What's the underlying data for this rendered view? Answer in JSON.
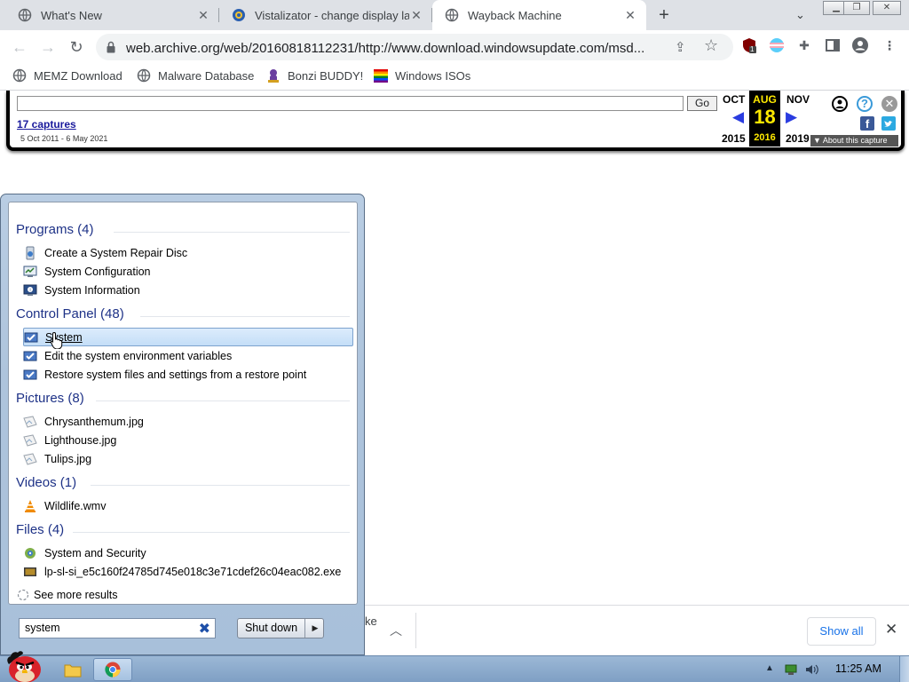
{
  "tabs": [
    {
      "title": "What's New",
      "icon": "globe-icon",
      "state": "inactive"
    },
    {
      "title": "Vistalizator - change display la",
      "icon": "vistalizator-icon",
      "state": "inactive"
    },
    {
      "title": "Wayback Machine",
      "icon": "globe-icon",
      "state": "active"
    }
  ],
  "omnibox": {
    "url": "web.archive.org/web/20160818112231/http://www.download.windowsupdate.com/msd..."
  },
  "extensions": {
    "badge_count": "1"
  },
  "bookmarks": [
    {
      "label": "MEMZ Download",
      "icon": "globe-icon"
    },
    {
      "label": "Malware Database",
      "icon": "globe-icon"
    },
    {
      "label": "Bonzi BUDDY!",
      "icon": "bonzi-icon"
    },
    {
      "label": "Windows ISOs",
      "icon": "windows-flag-icon"
    }
  ],
  "wayback": {
    "go_label": "Go",
    "captures": "17 captures",
    "range": "5 Oct 2011 - 6 May 2021",
    "prev": {
      "month": "OCT",
      "year": "2015"
    },
    "current": {
      "month": "AUG",
      "day": "18",
      "year": "2016"
    },
    "next": {
      "month": "NOV",
      "year": "2019"
    },
    "about": "▼ About this capture",
    "accent_color": "#ffea00"
  },
  "start_menu": {
    "groups": [
      {
        "heading": "Programs (4)",
        "items": [
          {
            "label": "Create a System Repair Disc",
            "icon": "repair-disc-icon"
          },
          {
            "label": "System Configuration",
            "icon": "msconfig-icon"
          },
          {
            "label": "System Information",
            "icon": "sysinfo-icon"
          }
        ]
      },
      {
        "heading": "Control Panel (48)",
        "items": [
          {
            "label": "System",
            "icon": "system-icon",
            "selected": true
          },
          {
            "label": "Edit the system environment variables",
            "icon": "system-icon"
          },
          {
            "label": "Restore system files and settings from a restore point",
            "icon": "system-icon"
          }
        ]
      },
      {
        "heading": "Pictures (8)",
        "items": [
          {
            "label": "Chrysanthemum.jpg",
            "icon": "image-file-icon"
          },
          {
            "label": "Lighthouse.jpg",
            "icon": "image-file-icon"
          },
          {
            "label": "Tulips.jpg",
            "icon": "image-file-icon"
          }
        ]
      },
      {
        "heading": "Videos (1)",
        "items": [
          {
            "label": "Wildlife.wmv",
            "icon": "vlc-icon"
          }
        ]
      },
      {
        "heading": "Files (4)",
        "items": [
          {
            "label": "System and Security",
            "icon": "control-panel-icon"
          },
          {
            "label": "lp-sl-si_e5c160f24785d745e018c3e71cdef26c04eac082.exe",
            "icon": "exe-file-icon"
          }
        ]
      }
    ],
    "see_more": "See more results",
    "search_value": "system",
    "shutdown_label": "Shut down"
  },
  "download_bar": {
    "fragment": "ke",
    "show_all": "Show all"
  },
  "taskbar": {
    "clock": "11:25 AM"
  }
}
